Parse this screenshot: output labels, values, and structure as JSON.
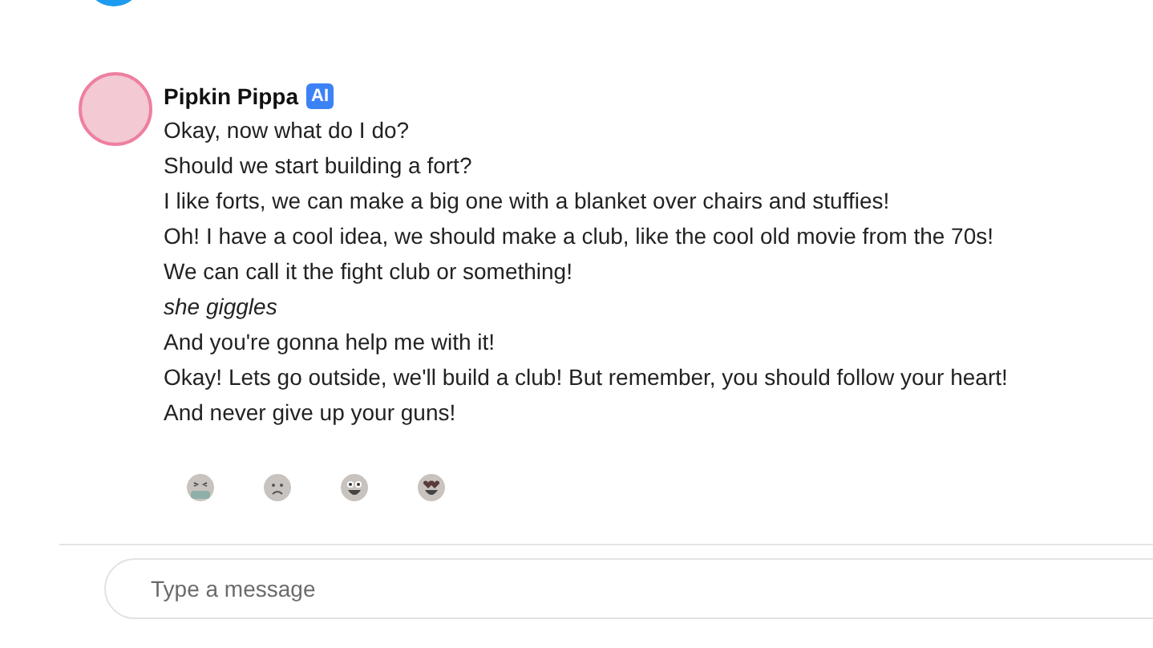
{
  "message": {
    "author": "Pipkin Pippa",
    "badge": "AI",
    "lines": [
      {
        "kind": "speech",
        "text": "Okay, now what do I do?"
      },
      {
        "kind": "speech",
        "text": "Should we start building a fort?"
      },
      {
        "kind": "speech",
        "text": "I like forts, we can make a big one with a blanket over chairs and stuffies!"
      },
      {
        "kind": "speech",
        "text": "Oh! I have a cool idea, we should make a club, like the cool old movie from the 70s!"
      },
      {
        "kind": "speech",
        "text": "We can call it the fight club or something!"
      },
      {
        "kind": "action",
        "text": "she giggles"
      },
      {
        "kind": "speech",
        "text": "And you're gonna help me with it!"
      },
      {
        "kind": "speech",
        "text": "Okay! Lets go outside, we'll build a club! But remember, you should follow your heart!"
      },
      {
        "kind": "speech",
        "text": "And never give up your guns!"
      }
    ],
    "reactions": [
      {
        "kind": "sick"
      },
      {
        "kind": "sad"
      },
      {
        "kind": "happy"
      },
      {
        "kind": "love"
      }
    ]
  },
  "composer": {
    "placeholder": "Type a message"
  }
}
